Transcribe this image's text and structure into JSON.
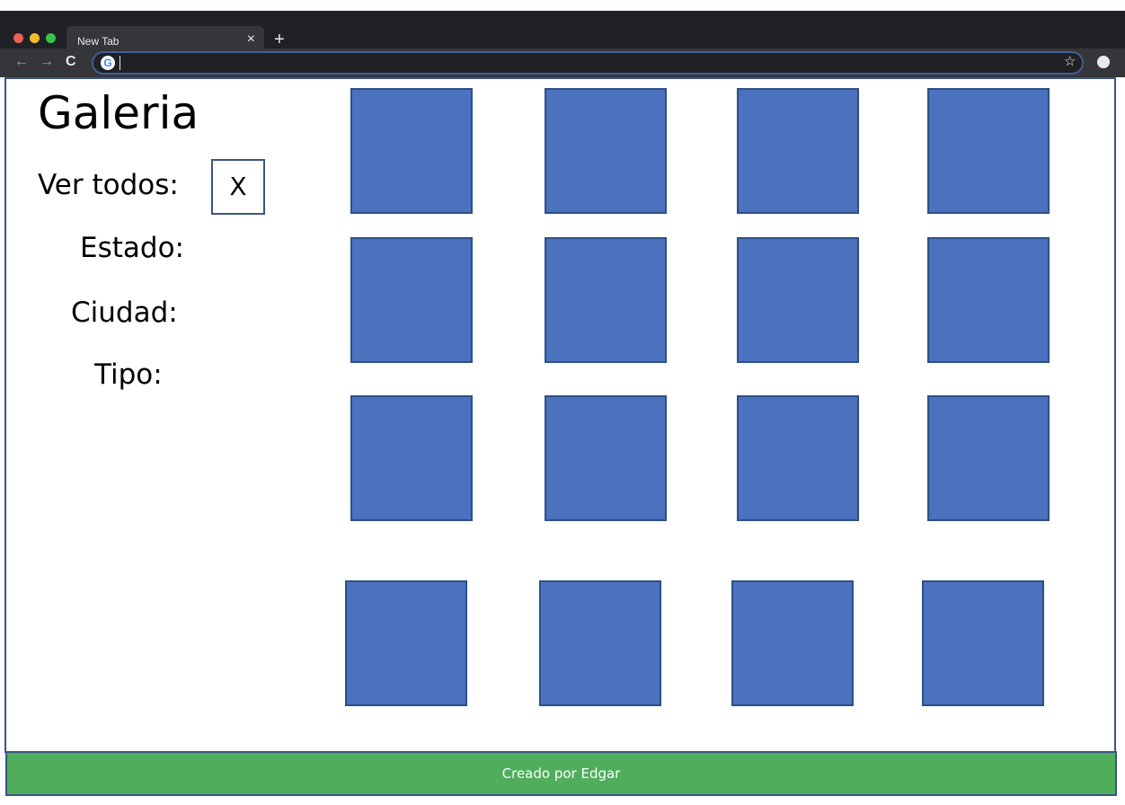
{
  "browser": {
    "tab_title": "New Tab",
    "tab_close": "×",
    "new_tab": "+",
    "back": "←",
    "forward": "→",
    "reload": "C",
    "search_engine_icon": "G",
    "star": "☆"
  },
  "page": {
    "title": "Galeria",
    "filters": {
      "ver_todos_label": "Ver todos:",
      "ver_todos_value": "X",
      "estado_label": "Estado:",
      "ciudad_label": "Ciudad:",
      "tipo_label": "Tipo:"
    },
    "gallery": {
      "tile_color": "#4a72be",
      "tile_count": 16
    },
    "footer": "Creado por Edgar"
  },
  "colors": {
    "footer_green": "#4fad5b",
    "border_blue": "#3a5584"
  }
}
